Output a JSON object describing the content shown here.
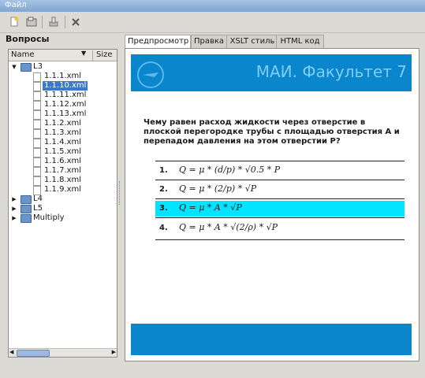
{
  "window": {
    "title": "Файл"
  },
  "toolbar": {
    "buttons": [
      "new-file-icon",
      "open-icon",
      "export-icon",
      "delete-icon"
    ]
  },
  "left": {
    "title": "Вопросы",
    "columns": {
      "name": "Name",
      "size": "Size"
    },
    "tree": [
      {
        "label": "L3",
        "type": "folder",
        "expanded": true
      },
      {
        "label": "1.1.1.xml",
        "type": "file"
      },
      {
        "label": "1.1.10.xml",
        "type": "file",
        "selected": true
      },
      {
        "label": "1.1.11.xml",
        "type": "file"
      },
      {
        "label": "1.1.12.xml",
        "type": "file"
      },
      {
        "label": "1.1.13.xml",
        "type": "file"
      },
      {
        "label": "1.1.2.xml",
        "type": "file"
      },
      {
        "label": "1.1.3.xml",
        "type": "file"
      },
      {
        "label": "1.1.4.xml",
        "type": "file"
      },
      {
        "label": "1.1.5.xml",
        "type": "file"
      },
      {
        "label": "1.1.6.xml",
        "type": "file"
      },
      {
        "label": "1.1.7.xml",
        "type": "file"
      },
      {
        "label": "1.1.8.xml",
        "type": "file"
      },
      {
        "label": "1.1.9.xml",
        "type": "file"
      },
      {
        "label": "L4",
        "type": "folder",
        "expanded": false
      },
      {
        "label": "L5",
        "type": "folder",
        "expanded": false
      },
      {
        "label": "Multiply",
        "type": "folder",
        "expanded": false
      }
    ]
  },
  "tabs": [
    "Предпросмотр",
    "Правка",
    "XSLT стиль",
    "HTML код"
  ],
  "preview": {
    "banner_title": "МАИ. Факультет 7",
    "question": "Чему равен расход жидкости через отверстие в плоской перегородке трубы с площадью отверстия А и перепадом давления на этом отверстии P?",
    "answers": [
      {
        "num": "1.",
        "formula": "Q = μ * (d/p) * √0.5 * P"
      },
      {
        "num": "2.",
        "formula": "Q = μ * (2/p) * √P"
      },
      {
        "num": "3.",
        "formula": "Q = μ * A * √P",
        "highlighted": true
      },
      {
        "num": "4.",
        "formula": "Q = μ * A * √(2/ρ) * √P"
      }
    ],
    "colors": {
      "banner": "#0a86cc",
      "highlight": "#00e4ff"
    }
  }
}
